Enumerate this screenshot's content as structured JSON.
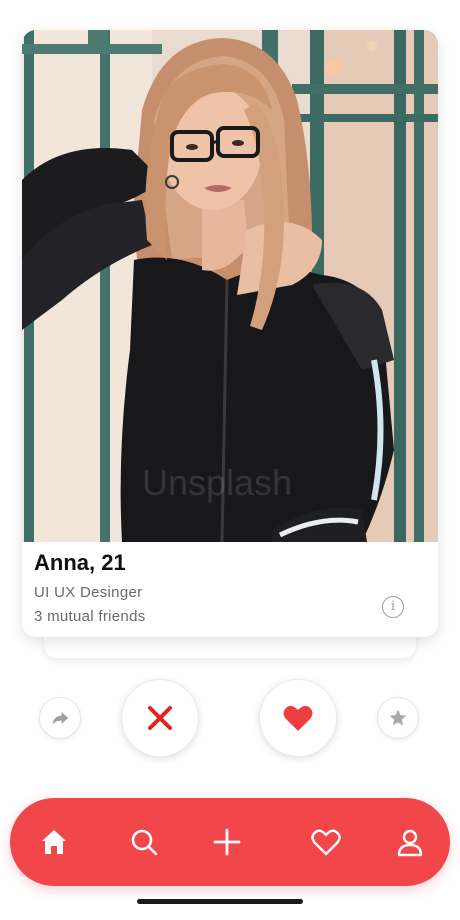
{
  "profile": {
    "name_age": "Anna, 21",
    "job": "UI UX Desinger",
    "mutual_friends": "3 mutual friends",
    "info_glyph": "i"
  },
  "actions": {
    "share_icon": "share-arrow-icon",
    "nope_icon": "close-x-icon",
    "like_icon": "heart-filled-icon",
    "super_icon": "star-icon"
  },
  "bottom_nav": {
    "items": [
      {
        "id": "home",
        "icon": "home-icon",
        "active": true
      },
      {
        "id": "search",
        "icon": "search-icon",
        "active": false
      },
      {
        "id": "add",
        "icon": "plus-icon",
        "active": false
      },
      {
        "id": "likes",
        "icon": "heart-outline-icon",
        "active": false
      },
      {
        "id": "profile",
        "icon": "user-icon",
        "active": false
      }
    ]
  },
  "colors": {
    "accent": "#f2474a",
    "nope_red": "#e02424",
    "text_primary": "#111111",
    "text_secondary": "#6a6a6a"
  }
}
